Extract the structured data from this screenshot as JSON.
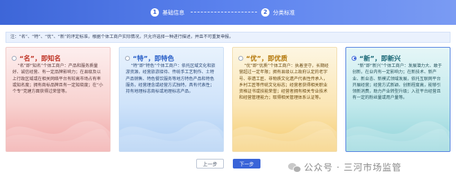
{
  "stepper": {
    "steps": [
      {
        "number": "1",
        "label": "基础信息"
      },
      {
        "number": "2",
        "label": "分类标准"
      }
    ],
    "colors": {
      "accent": "#3a64d8"
    }
  },
  "notice": {
    "text": "注：“名”、“特”、“优”、“新”的评定标准，根据个体工商户实际情况，只允许选择一种进行描述，并且不可重复申报。"
  },
  "cards": [
    {
      "title": "“名”，即知名",
      "selected": false,
      "body": "“名”即“知名”个体工商户：产品和服务质量好、诚信经营、有一定品牌影响力；在县级及以上行政区域或在相关网络平台有较高市场占有率或知名度；拥有商标品牌且有一定知晓度；在“小个专”党建方面获得过荣誉等。"
    },
    {
      "title": "“特”，即特色",
      "selected": false,
      "body": "“特”即“特色”个体工商户：依托区域文化和旅游资源，经营旅游接待、传统手工艺制作、土特产品销售、特色餐饮服务等地方特色产品和特色服务，经营理念或经营方式独特，具有代表性；持有地理标志商标或地理标志产品。"
    },
    {
      "title": "“优”，即优质",
      "selected": false,
      "body": "“优”即“优质”个体工商户：执着坚守，长期经营超过一定年限；拥有县级以上政府认定的老字号、非遗工匠、非物质文化遗产代表性传承人，乡村工匠等传统文化标志；经营者获得相关职业资格证书或技能荣誉；经营者拥有相关专业技术和经营管理能力；取得相关管理体系认证等。"
    },
    {
      "title": "“新”，即新兴",
      "selected": true,
      "body": "“新”即“新兴”个体工商户：发展潜力大、敢于创新，在业内有一定影响力；在新技术、新产业、新业态、新模式领域发展，依托互联网平台开展经营；经营方式新颖、创新程度高，能够引领新消费，助力产业转型升级；入驻平台经营且有一定的粉丝量或用户量等。"
    }
  ],
  "buttons": {
    "prev_label": "上一步",
    "next_label": "下一步"
  },
  "watermark": {
    "text": "公众号 · 三河市场监管"
  }
}
